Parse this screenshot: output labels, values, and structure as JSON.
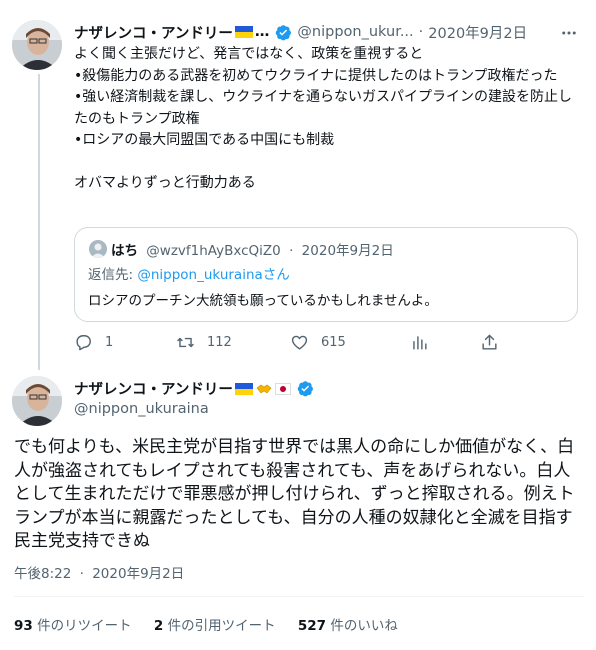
{
  "tweet1": {
    "author_name": "ナザレンコ・アンドリー",
    "name_suffix": "…",
    "handle": "@nippon_ukur...",
    "separator": "·",
    "date": "2020年9月2日",
    "body": "よく聞く主張だけど、発言ではなく、政策を重視すると\n•殺傷能力のある武器を初めてウクライナに提供したのはトランプ政権だった\n•強い経済制裁を課し、ウクライナを通らないガスパイプラインの建設を防止したのもトランプ政権\n•ロシアの最大同盟国である中国にも制裁\n\nオバマよりずっと行動力ある",
    "quote": {
      "author_name": "はち",
      "handle": "@wzvf1hAyBxcQiZ0",
      "separator": "·",
      "date": "2020年9月2日",
      "reply_prefix": "返信先: ",
      "reply_to": "@nippon_ukurainaさん",
      "text": "ロシアのプーチン大統領も願っているかもしれませんよ。"
    },
    "actions": {
      "reply_count": "1",
      "retweet_count": "112",
      "like_count": "615"
    }
  },
  "tweet2": {
    "author_name": "ナザレンコ・アンドリー",
    "handle": "@nippon_ukuraina",
    "body": "でも何よりも、米民主党が目指す世界では黒人の命にしか価値がなく、白人が強盗されてもレイプされても殺害されても、声をあげられない。白人として生まれただけで罪悪感が押し付けられ、ずっと搾取される。例えトランプが本当に親露だったとしても、自分の人種の奴隷化と全滅を目指す民主党支持できぬ",
    "time": "午後8:22",
    "separator": "·",
    "date": "2020年9月2日",
    "stats": {
      "retweets": "93",
      "retweets_label": "件のリツイート",
      "quotes": "2",
      "quotes_label": "件の引用ツイート",
      "likes": "527",
      "likes_label": "件のいいね"
    }
  },
  "colors": {
    "accent": "#1d9bf0",
    "text": "#0f1419",
    "muted": "#536471",
    "border": "#cfd9de",
    "flag_blue": "#1f5bd8",
    "flag_yellow": "#ffd20a"
  }
}
